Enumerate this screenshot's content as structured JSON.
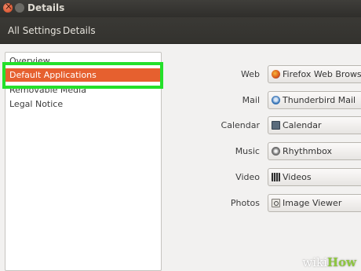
{
  "window": {
    "title": "Details"
  },
  "toolbar": {
    "all_settings": "All Settings",
    "details": "Details"
  },
  "sidebar": {
    "items": [
      {
        "label": "Overview"
      },
      {
        "label": "Default Applications",
        "selected": true
      },
      {
        "label": "Removable Media"
      },
      {
        "label": "Legal Notice"
      }
    ]
  },
  "apps": [
    {
      "label": "Web",
      "value": "Firefox Web Browser",
      "icon": "firefox-icon"
    },
    {
      "label": "Mail",
      "value": "Thunderbird Mail",
      "icon": "thunderbird-icon"
    },
    {
      "label": "Calendar",
      "value": "Calendar",
      "icon": "calendar-icon"
    },
    {
      "label": "Music",
      "value": "Rhythmbox",
      "icon": "rhythmbox-icon"
    },
    {
      "label": "Video",
      "value": "Videos",
      "icon": "videos-icon"
    },
    {
      "label": "Photos",
      "value": "Image Viewer",
      "icon": "image-viewer-icon"
    }
  ],
  "watermark": {
    "wiki": "wiki",
    "how": "How"
  },
  "colors": {
    "selection": "#e6602f",
    "highlight": "#24e02a"
  }
}
